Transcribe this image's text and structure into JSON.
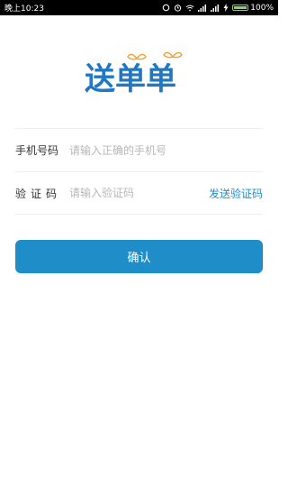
{
  "status_bar": {
    "left_text": "晚上10:23",
    "battery_text": "100%"
  },
  "logo": {
    "text": "送单单",
    "brand_color": "#1f78c1",
    "accent_color": "#f2a33a"
  },
  "form": {
    "phone_label": "手机号码",
    "phone_placeholder": "请输入正确的手机号",
    "code_label": "验证码",
    "code_placeholder": "请输入验证码",
    "send_code_label": "发送验证码"
  },
  "confirm_button": {
    "label": "确认"
  },
  "colors": {
    "accent": "#1f8ec8",
    "status_bar": "#000000"
  }
}
